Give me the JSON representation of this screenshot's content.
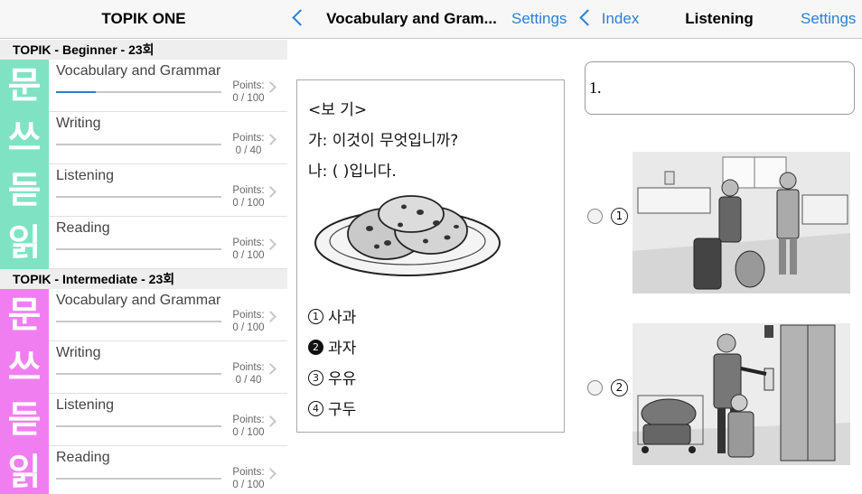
{
  "pane1": {
    "title": "TOPIK ONE",
    "sections": [
      {
        "header": "TOPIK - Beginner - 23회",
        "rows": [
          {
            "glyph": "문",
            "title": "Vocabulary and Grammar",
            "points_label": "Points:",
            "points": "0 / 100",
            "progress": 0.24
          },
          {
            "glyph": "쓰",
            "title": "Writing",
            "points_label": "Points:",
            "points": "0 / 40",
            "progress": 0
          },
          {
            "glyph": "듣",
            "title": "Listening",
            "points_label": "Points:",
            "points": "0 / 100",
            "progress": 0
          },
          {
            "glyph": "읽",
            "title": "Reading",
            "points_label": "Points:",
            "points": "0 / 100",
            "progress": 0
          }
        ]
      },
      {
        "header": "TOPIK - Intermediate - 23회",
        "rows": [
          {
            "glyph": "문",
            "title": "Vocabulary and Grammar",
            "points_label": "Points:",
            "points": "0 / 100",
            "progress": 0
          },
          {
            "glyph": "쓰",
            "title": "Writing",
            "points_label": "Points:",
            "points": "0 / 40",
            "progress": 0
          },
          {
            "glyph": "듣",
            "title": "Listening",
            "points_label": "Points:",
            "points": "0 / 100",
            "progress": 0
          },
          {
            "glyph": "읽",
            "title": "Reading",
            "points_label": "Points:",
            "points": "0 / 100",
            "progress": 0
          }
        ]
      }
    ]
  },
  "pane2": {
    "title": "Vocabulary and Gram...",
    "settings": "Settings",
    "question": {
      "box_label": "<보 기>",
      "line_a": "가: 이것이 무엇입니까?",
      "line_b": "나: ( )입니다.",
      "options": [
        {
          "num": "1",
          "text": "사과",
          "selected": false
        },
        {
          "num": "2",
          "text": "과자",
          "selected": true
        },
        {
          "num": "3",
          "text": "우유",
          "selected": false
        },
        {
          "num": "4",
          "text": "구두",
          "selected": false
        }
      ]
    }
  },
  "pane3": {
    "back": "Index",
    "title": "Listening",
    "settings": "Settings",
    "question_text": "1.",
    "choices": [
      {
        "num": "1"
      },
      {
        "num": "2"
      }
    ]
  },
  "colors": {
    "accent": "#2a7fd6",
    "beginner_tile": "#7fe3c3",
    "intermediate_tile": "#f17ef0"
  }
}
